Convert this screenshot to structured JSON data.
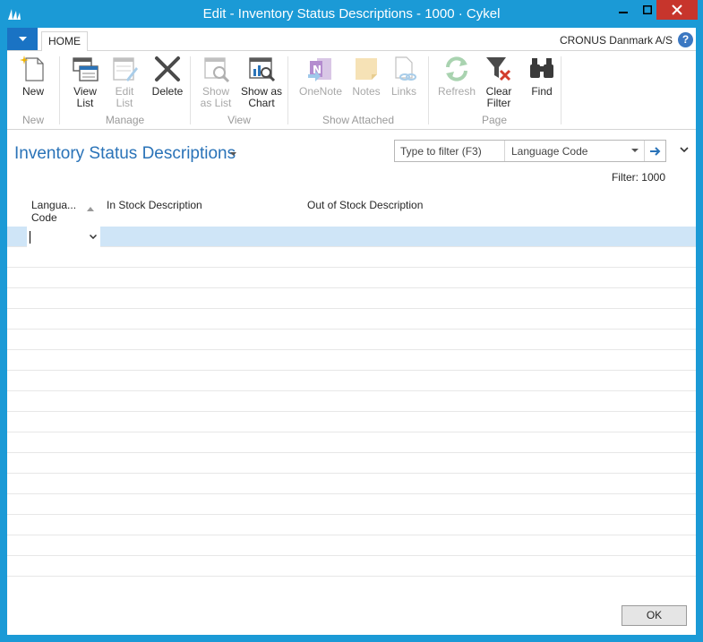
{
  "window": {
    "title": "Edit - Inventory Status Descriptions - 1000 · Cykel"
  },
  "ribbon": {
    "tab_home": "HOME",
    "company": "CRONUS Danmark A/S",
    "help": "?",
    "groups": {
      "new": "New",
      "manage": "Manage",
      "view": "View",
      "show_attached": "Show Attached",
      "page": "Page"
    },
    "buttons": {
      "new": "New",
      "view_list_1": "View",
      "view_list_2": "List",
      "edit_list_1": "Edit",
      "edit_list_2": "List",
      "delete": "Delete",
      "show_as_list_1": "Show",
      "show_as_list_2": "as List",
      "show_as_chart_1": "Show as",
      "show_as_chart_2": "Chart",
      "onenote": "OneNote",
      "notes": "Notes",
      "links": "Links",
      "refresh": "Refresh",
      "clear_filter_1": "Clear",
      "clear_filter_2": "Filter",
      "find": "Find"
    }
  },
  "page": {
    "title": "Inventory Status Descriptions",
    "filter_placeholder": "Type to filter (F3)",
    "filter_field": "Language Code",
    "filter_status": "Filter: 1000"
  },
  "grid": {
    "col_language_1": "Langua...",
    "col_language_2": "Code",
    "col_in_stock": "In Stock Description",
    "col_out_of_stock": "Out of Stock Description"
  },
  "footer": {
    "ok": "OK"
  },
  "colors": {
    "frame": "#1b9ad6",
    "accent": "#2a73b8",
    "selected_row": "#cfe5f7",
    "close": "#c7352c"
  }
}
